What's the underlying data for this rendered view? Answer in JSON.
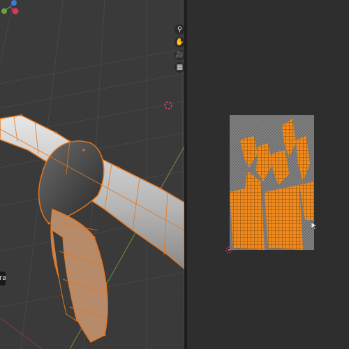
{
  "viewport": {
    "panel": "3d-viewport",
    "mode": "edit-mode",
    "object_label": "ra",
    "gizmo_icons": [
      "axis-gizmo-icon"
    ],
    "nav_buttons": [
      {
        "name": "zoom-icon",
        "glyph": "⚲"
      },
      {
        "name": "pan-hand-icon",
        "glyph": "✋"
      },
      {
        "name": "camera-icon",
        "glyph": "🎥"
      },
      {
        "name": "grid-view-icon",
        "glyph": "▦"
      }
    ],
    "colors": {
      "background": "#3a3a3a",
      "mesh": "#c9c9c9",
      "wire": "#e8761a",
      "grid": "#4a4a4a"
    }
  },
  "uv_editor": {
    "panel": "uv-editor",
    "colors": {
      "background": "#2e2e2e",
      "checker": "#6e6e6e",
      "islands": "#f08a1c",
      "cursor": "#c23b5a"
    }
  }
}
